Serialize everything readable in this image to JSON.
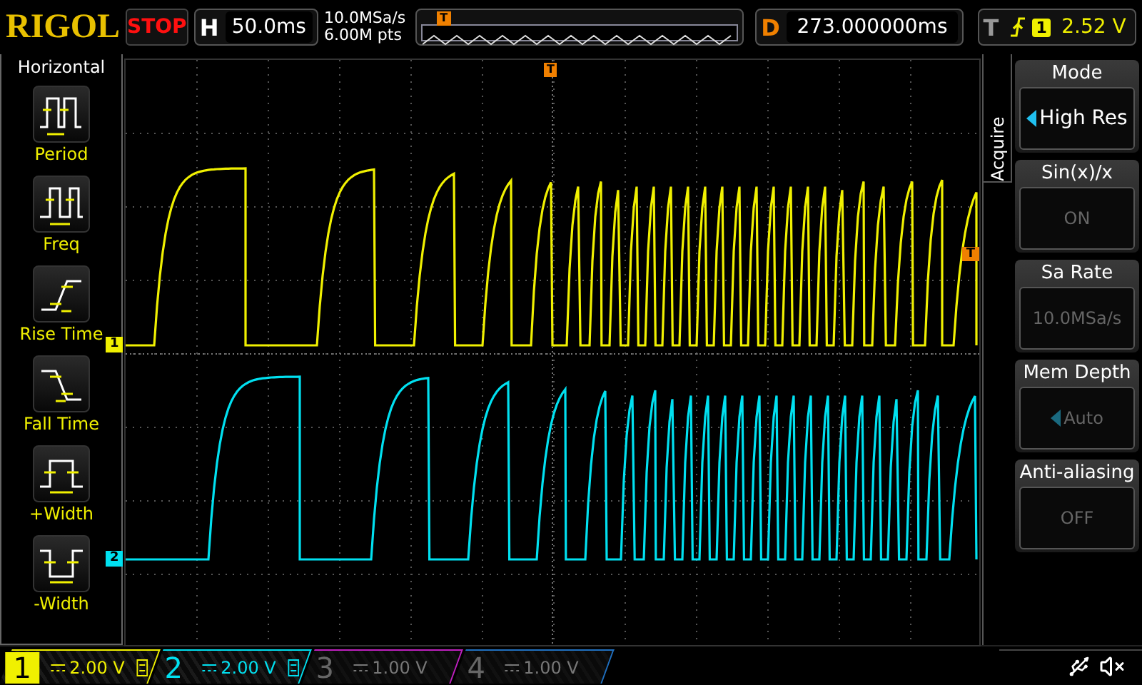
{
  "brand": "RIGOL",
  "run_state": "STOP",
  "horizontal": {
    "label": "H",
    "timebase": "50.0ms"
  },
  "acquisition": {
    "sample_rate": "10.0MSa/s",
    "memory": "6.00M pts"
  },
  "overview": {
    "trigger_marker": "T"
  },
  "delay": {
    "label": "D",
    "value": "273.000000ms"
  },
  "trigger": {
    "label": "T",
    "source": "1",
    "level": "2.52 V"
  },
  "measure_menu": {
    "title": "Horizontal",
    "items": [
      {
        "kind": "period",
        "label": "Period"
      },
      {
        "kind": "freq",
        "label": "Freq"
      },
      {
        "kind": "rise",
        "label": "Rise Time"
      },
      {
        "kind": "fall",
        "label": "Fall Time"
      },
      {
        "kind": "pwidth",
        "label": "+Width"
      },
      {
        "kind": "nwidth",
        "label": "-Width"
      }
    ]
  },
  "display": {
    "trigger_position_marker": "T",
    "trigger_level_marker": "T",
    "channel_markers": [
      {
        "label": "1"
      },
      {
        "label": "2"
      }
    ]
  },
  "acquire_menu": {
    "title": "Acquire",
    "items": [
      {
        "label": "Mode",
        "value": "High Res",
        "disabled": false,
        "arrow": true
      },
      {
        "label": "Sin(x)/x",
        "value": "ON",
        "disabled": true,
        "arrow": false
      },
      {
        "label": "Sa Rate",
        "value": "10.0MSa/s",
        "disabled": true,
        "arrow": false
      },
      {
        "label": "Mem Depth",
        "value": "Auto",
        "disabled": true,
        "arrow": true
      },
      {
        "label": "Anti-aliasing",
        "value": "OFF",
        "disabled": true,
        "arrow": false
      }
    ]
  },
  "channels": [
    {
      "number": "1",
      "scale": "2.00 V",
      "on": true,
      "selected": true,
      "color": "#f0f000"
    },
    {
      "number": "2",
      "scale": "2.00 V",
      "on": true,
      "selected": false,
      "color": "#00e0f0"
    },
    {
      "number": "3",
      "scale": "1.00 V",
      "on": false,
      "selected": false,
      "color": "#c020c0"
    },
    {
      "number": "4",
      "scale": "1.00 V",
      "on": false,
      "selected": false,
      "color": "#2070c0"
    }
  ]
}
